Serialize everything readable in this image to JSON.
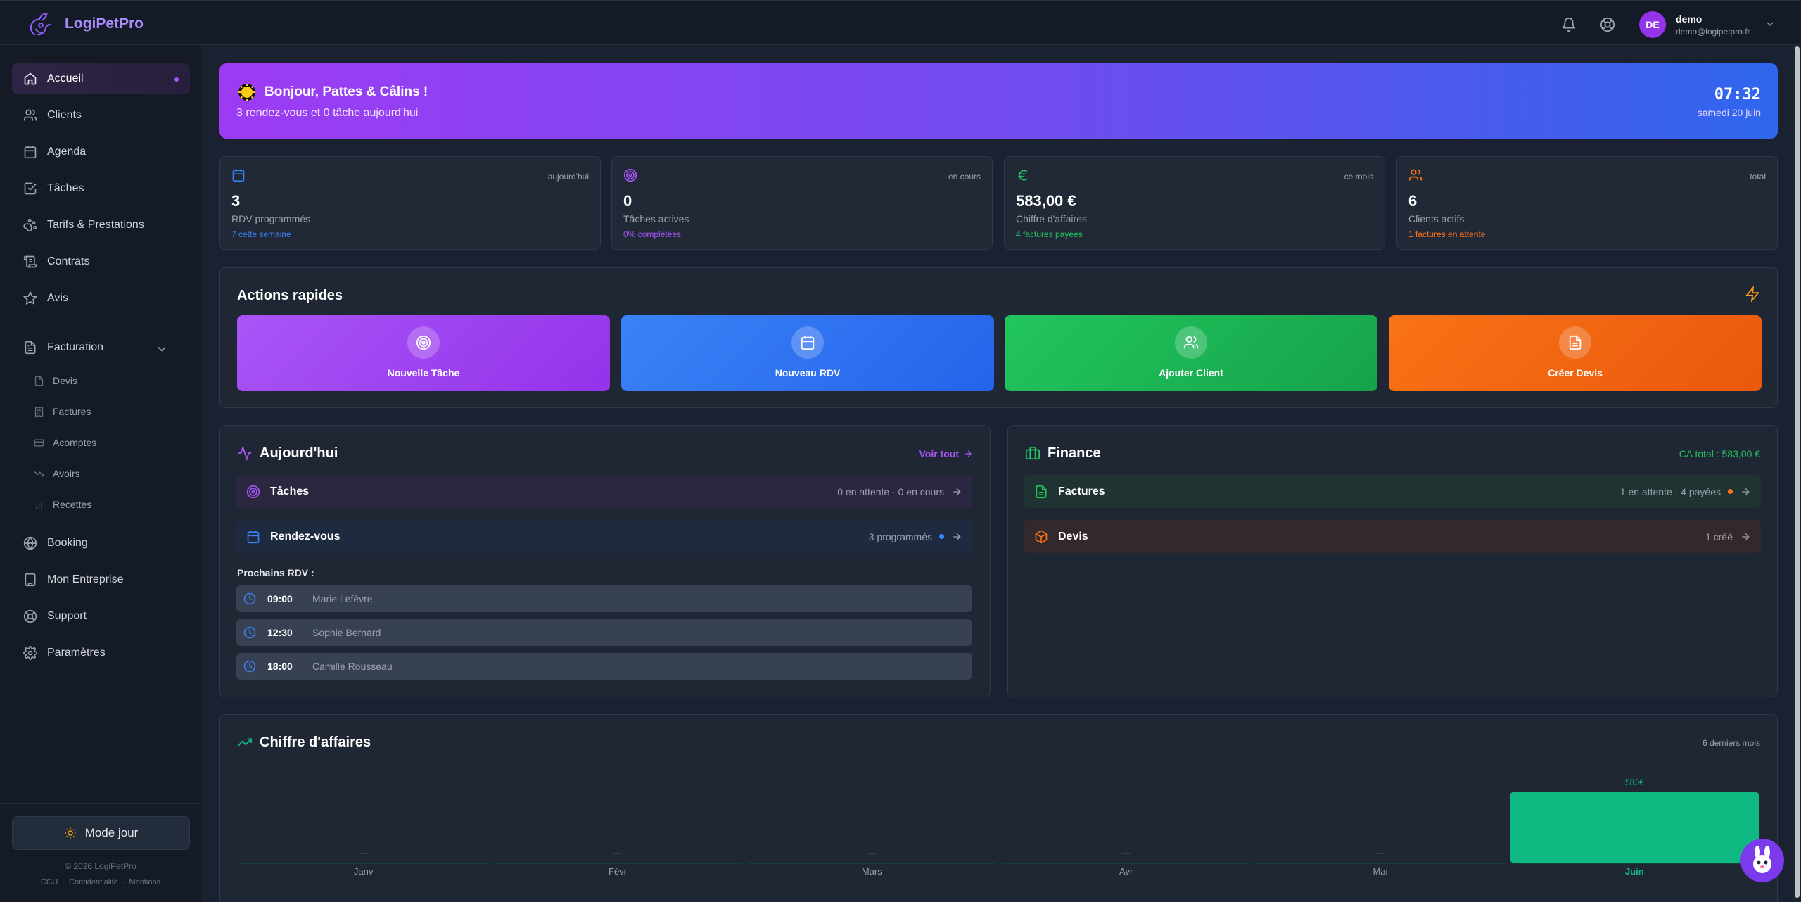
{
  "app": {
    "name": "LogiPetPro"
  },
  "user": {
    "initials": "DE",
    "name": "demo",
    "email": "demo@logipetpro.fr"
  },
  "sidebar": {
    "items": [
      {
        "label": "Accueil"
      },
      {
        "label": "Clients"
      },
      {
        "label": "Agenda"
      },
      {
        "label": "Tâches"
      },
      {
        "label": "Tarifs & Prestations"
      },
      {
        "label": "Contrats"
      },
      {
        "label": "Avis"
      },
      {
        "label": "Facturation"
      },
      {
        "label": "Booking"
      },
      {
        "label": "Mon Entreprise"
      },
      {
        "label": "Support"
      },
      {
        "label": "Paramètres"
      }
    ],
    "sub_items": [
      {
        "label": "Devis"
      },
      {
        "label": "Factures"
      },
      {
        "label": "Acomptes"
      },
      {
        "label": "Avoirs"
      },
      {
        "label": "Recettes"
      }
    ],
    "mode_label": "Mode jour",
    "copyright": "© 2026 LogiPetPro",
    "legal": [
      "CGU",
      "Confidentialité",
      "Mentions"
    ]
  },
  "banner": {
    "greeting": "Bonjour, Pattes & Câlins !",
    "summary": "3 rendez-vous et 0 tâche aujourd'hui",
    "time": "07:32",
    "date": "samedi 20 juin"
  },
  "stats": [
    {
      "tag": "aujourd'hui",
      "value": "3",
      "label": "RDV programmés",
      "sub": "7 cette semaine",
      "color": "#3b82f6",
      "icon": "calendar-icon"
    },
    {
      "tag": "en cours",
      "value": "0",
      "label": "Tâches actives",
      "sub": "0% complétées",
      "color": "#a855f7",
      "icon": "target-icon"
    },
    {
      "tag": "ce mois",
      "value": "583,00 €",
      "label": "Chiffre d'affaires",
      "sub": "4 factures payées",
      "color": "#22c55e",
      "icon": "euro-icon"
    },
    {
      "tag": "total",
      "value": "6",
      "label": "Clients actifs",
      "sub": "1 factures en attente",
      "color": "#f97316",
      "icon": "users-icon"
    }
  ],
  "quick_actions": {
    "title": "Actions rapides",
    "items": [
      {
        "label": "Nouvelle Tâche"
      },
      {
        "label": "Nouveau RDV"
      },
      {
        "label": "Ajouter Client"
      },
      {
        "label": "Créer Devis"
      }
    ]
  },
  "today": {
    "title": "Aujourd'hui",
    "see_all": "Voir tout",
    "tasks": {
      "label": "Tâches",
      "status": "0 en attente · 0 en cours"
    },
    "appointments": {
      "label": "Rendez-vous",
      "status": "3 programmés"
    },
    "next_title": "Prochains RDV :",
    "next": [
      {
        "time": "09:00",
        "name": "Marie Lefèvre"
      },
      {
        "time": "12:30",
        "name": "Sophie Bernard"
      },
      {
        "time": "18:00",
        "name": "Camille Rousseau"
      }
    ]
  },
  "finance": {
    "title": "Finance",
    "total": "CA total : 583,00 €",
    "invoices": {
      "label": "Factures",
      "status": "1 en attente · 4 payées"
    },
    "quotes": {
      "label": "Devis",
      "status": "1 créé"
    }
  },
  "revenue": {
    "title": "Chiffre d'affaires",
    "period": "6 derniers mois"
  },
  "chart_data": {
    "type": "bar",
    "title": "Chiffre d'affaires",
    "categories": [
      "Janv",
      "Févr",
      "Mars",
      "Avr",
      "Mai",
      "Juin"
    ],
    "values": [
      0,
      0,
      0,
      0,
      0,
      583
    ],
    "value_labels": [
      "—",
      "—",
      "—",
      "—",
      "—",
      "583€"
    ],
    "highlight": "Juin",
    "color": "#10b981"
  }
}
